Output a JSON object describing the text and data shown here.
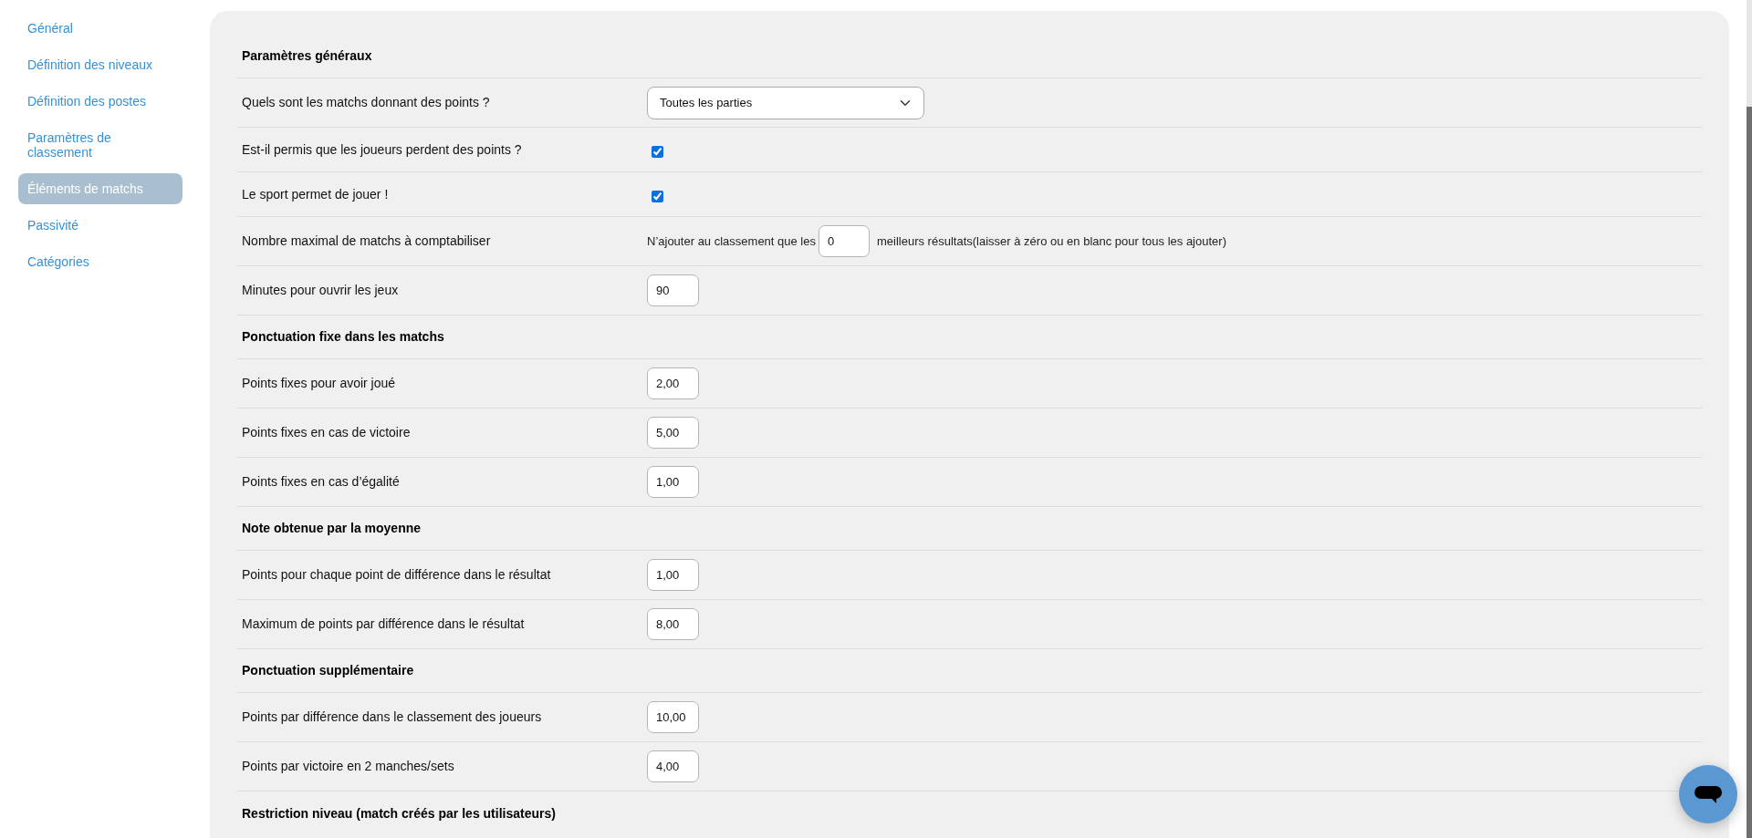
{
  "sidebar": {
    "items": [
      {
        "label": "Général",
        "selected": false
      },
      {
        "label": "Définition des niveaux",
        "selected": false
      },
      {
        "label": "Définition des postes",
        "selected": false
      },
      {
        "label": "Paramètres de classement",
        "selected": false
      },
      {
        "label": "Éléments de matchs",
        "selected": true
      },
      {
        "label": "Passivité",
        "selected": false
      },
      {
        "label": "Catégories",
        "selected": false
      }
    ]
  },
  "sections": [
    {
      "title": "Paramètres généraux",
      "rows": [
        {
          "kind": "select",
          "label": "Quels sont les matchs donnant des points ?",
          "value": "Toutes les parties"
        },
        {
          "kind": "checkbox",
          "label": "Est-il permis que les joueurs perdent des points ?",
          "checked": true
        },
        {
          "kind": "checkbox",
          "label": "Le sport permet de jouer !",
          "checked": true
        },
        {
          "kind": "inline_number",
          "label": "Nombre maximal de matchs à comptabiliser",
          "text_before": "N’ajouter au classement que les",
          "value": "0",
          "text_after": "meilleurs résultats(laisser à zéro ou en blanc pour tous les ajouter)"
        },
        {
          "kind": "number",
          "label": "Minutes pour ouvrir les jeux",
          "value": "90"
        }
      ]
    },
    {
      "title": "Ponctuation fixe dans les matchs",
      "rows": [
        {
          "kind": "number",
          "label": "Points fixes pour avoir joué",
          "value": "2,00"
        },
        {
          "kind": "number",
          "label": "Points fixes en cas de victoire",
          "value": "5,00"
        },
        {
          "kind": "number",
          "label": "Points fixes en cas d’égalité",
          "value": "1,00"
        }
      ]
    },
    {
      "title": "Note obtenue par la moyenne",
      "rows": [
        {
          "kind": "number",
          "label": "Points pour chaque point de différence dans le résultat",
          "value": "1,00"
        },
        {
          "kind": "number",
          "label": "Maximum de points par différence dans le résultat",
          "value": "8,00"
        }
      ]
    },
    {
      "title": "Ponctuation supplémentaire",
      "rows": [
        {
          "kind": "number",
          "label": "Points par différence dans le classement des joueurs",
          "value": "10,00"
        },
        {
          "kind": "number",
          "label": "Points par victoire en 2 manches/sets",
          "value": "4,00"
        }
      ]
    },
    {
      "title": "Restriction niveau (match créés par les utilisateurs)"
    }
  ]
}
